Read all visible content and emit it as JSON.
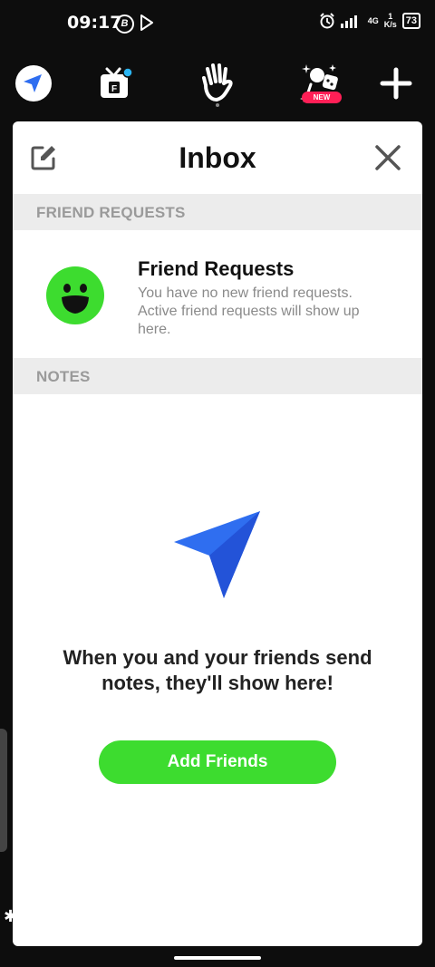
{
  "status_bar": {
    "time": "09:17",
    "b_badge": "B",
    "network": "4G",
    "speed_top": "1",
    "speed_unit": "K/s",
    "battery": "73"
  },
  "topnav": {
    "new_badge": "NEW"
  },
  "inbox": {
    "title": "Inbox",
    "sections": {
      "friend_requests": "FRIEND REQUESTS",
      "notes": "NOTES"
    },
    "friend_requests": {
      "title": "Friend Requests",
      "description": "You have no new friend requests. Active friend requests will show up here."
    },
    "empty_notes": {
      "message": "When you and your friends send notes, they'll show here!",
      "button": "Add Friends"
    }
  },
  "colors": {
    "accent_green": "#3ddc2f",
    "accent_blue": "#2f6ef0",
    "badge_red": "#ff1f56"
  }
}
